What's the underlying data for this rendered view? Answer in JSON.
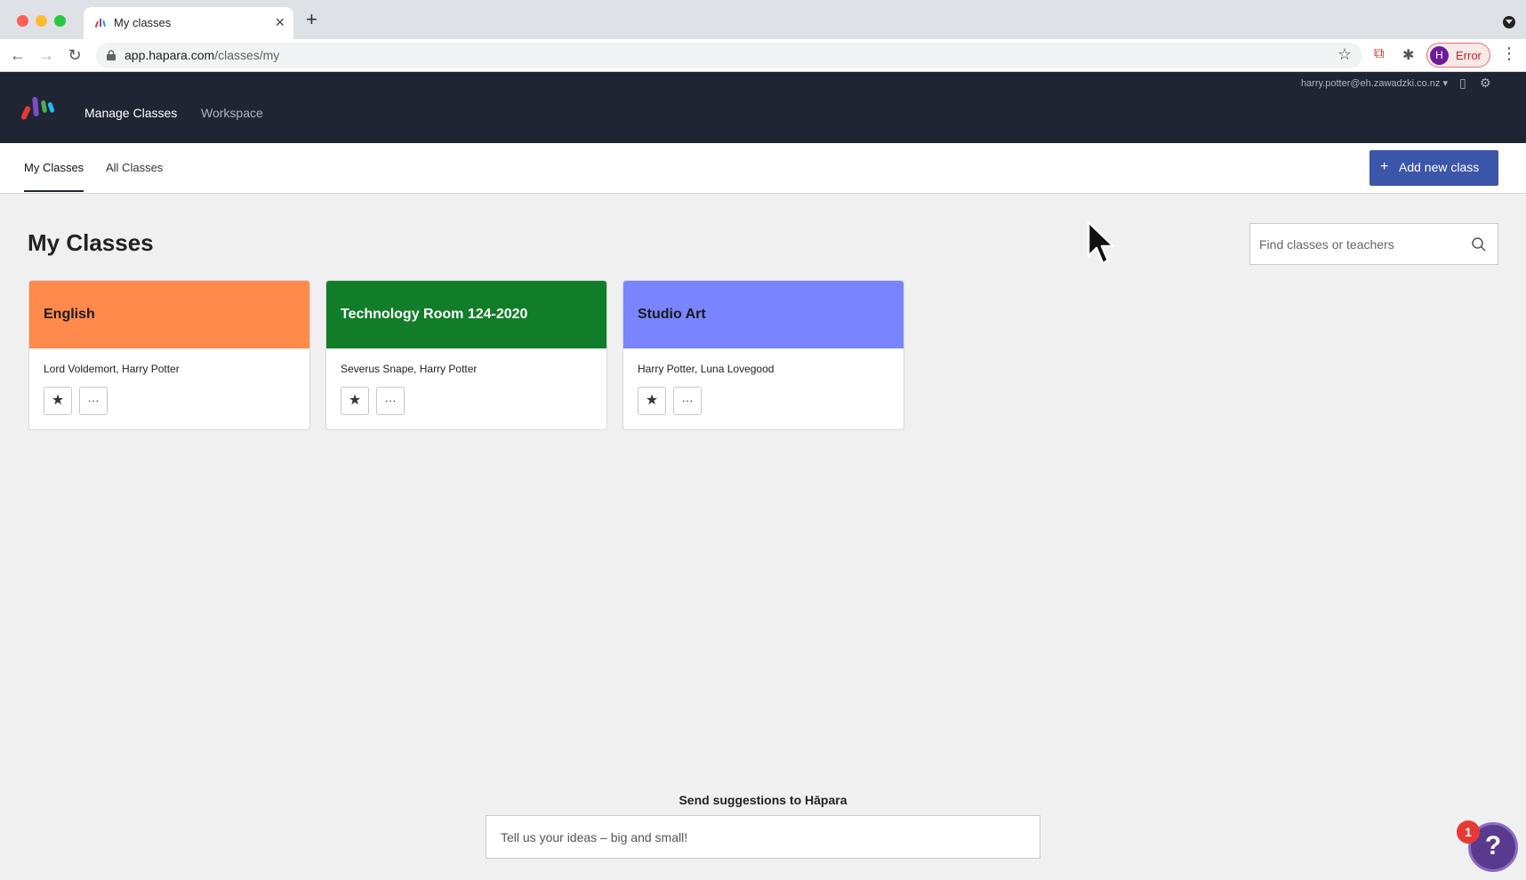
{
  "browser": {
    "tab_title": "My classes",
    "url_host": "app.hapara.com",
    "url_path": "/classes/my",
    "profile_initial": "H",
    "profile_status": "Error"
  },
  "header": {
    "nav": [
      {
        "label": "Manage Classes"
      },
      {
        "label": "Workspace"
      }
    ],
    "user_email": "harry.potter@eh.zawadzki.co.nz ▾"
  },
  "subnav": {
    "tabs": [
      {
        "label": "My Classes"
      },
      {
        "label": "All Classes"
      }
    ],
    "add_button_label": "Add new class"
  },
  "main": {
    "title": "My Classes",
    "search_placeholder": "Find classes or teachers",
    "classes": [
      {
        "name": "English",
        "teachers": "Lord Voldemort, Harry Potter",
        "color": "#ff8a4c",
        "text_color": "#1a1a1a"
      },
      {
        "name": "Technology Room 124-2020",
        "teachers": "Severus Snape, Harry Potter",
        "color": "#117d29",
        "text_color": "#ffffff"
      },
      {
        "name": "Studio Art",
        "teachers": "Harry Potter, Luna Lovegood",
        "color": "#7a84ff",
        "text_color": "#1a1a1a"
      }
    ]
  },
  "footer": {
    "suggest_label": "Send suggestions to Hāpara",
    "suggest_placeholder": "Tell us your ideas – big and small!",
    "help_badge": "1",
    "help_glyph": "?"
  },
  "colors": {
    "header_bg": "#1f2532",
    "primary_button": "#3b55a9"
  }
}
